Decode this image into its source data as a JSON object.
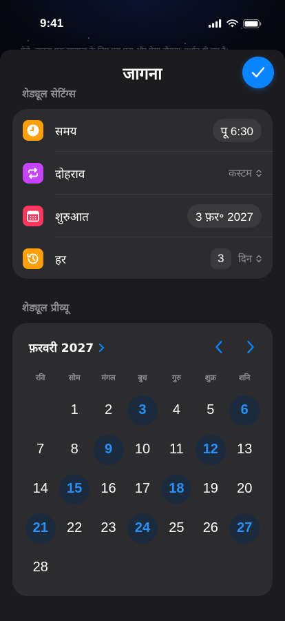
{
  "status_bar": {
    "time": "9:41"
  },
  "background_text": "गेसे, चाहता एक सामान्य के लिए पूरा घटा और ऐसा नौरामा अर्थात ग़ी गए हैं।",
  "sheet": {
    "title": "जागना",
    "done_label": "Done"
  },
  "schedule_settings": {
    "title": "शेड्यूल सेटिंग्स",
    "rows": [
      {
        "label": "समय",
        "value": "पू 6:30",
        "icon": "clock-icon",
        "icon_color": "#ff9f0a"
      },
      {
        "label": "दोहराव",
        "value": "कस्टम",
        "icon": "repeat-icon",
        "icon_color": "#c644fc"
      },
      {
        "label": "शुरुआत",
        "value": "3 फ़र॰ 2027",
        "icon": "calendar-icon",
        "icon_color": "#ff375f"
      },
      {
        "label": "हर",
        "value": "3",
        "unit": "दिन",
        "icon": "history-icon",
        "icon_color": "#ff9f0a"
      }
    ]
  },
  "preview": {
    "title": "शेड्यूल प्रीव्यू",
    "month_label": "फ़रवरी 2027",
    "accent": "#0a84ff",
    "weekdays": [
      "रवि",
      "सोम",
      "मंगल",
      "बुध",
      "गुरु",
      "शुक्र",
      "शनि"
    ],
    "weeks": [
      [
        "",
        "1",
        "2",
        "3",
        "4",
        "5",
        "6"
      ],
      [
        "7",
        "8",
        "9",
        "10",
        "11",
        "12",
        "13"
      ],
      [
        "14",
        "15",
        "16",
        "17",
        "18",
        "19",
        "20"
      ],
      [
        "21",
        "22",
        "23",
        "24",
        "25",
        "26",
        "27"
      ],
      [
        "28",
        "",
        "",
        "",
        "",
        "",
        ""
      ]
    ],
    "highlighted_days": [
      "3",
      "6",
      "9",
      "12",
      "15",
      "18",
      "21",
      "24",
      "27"
    ]
  }
}
